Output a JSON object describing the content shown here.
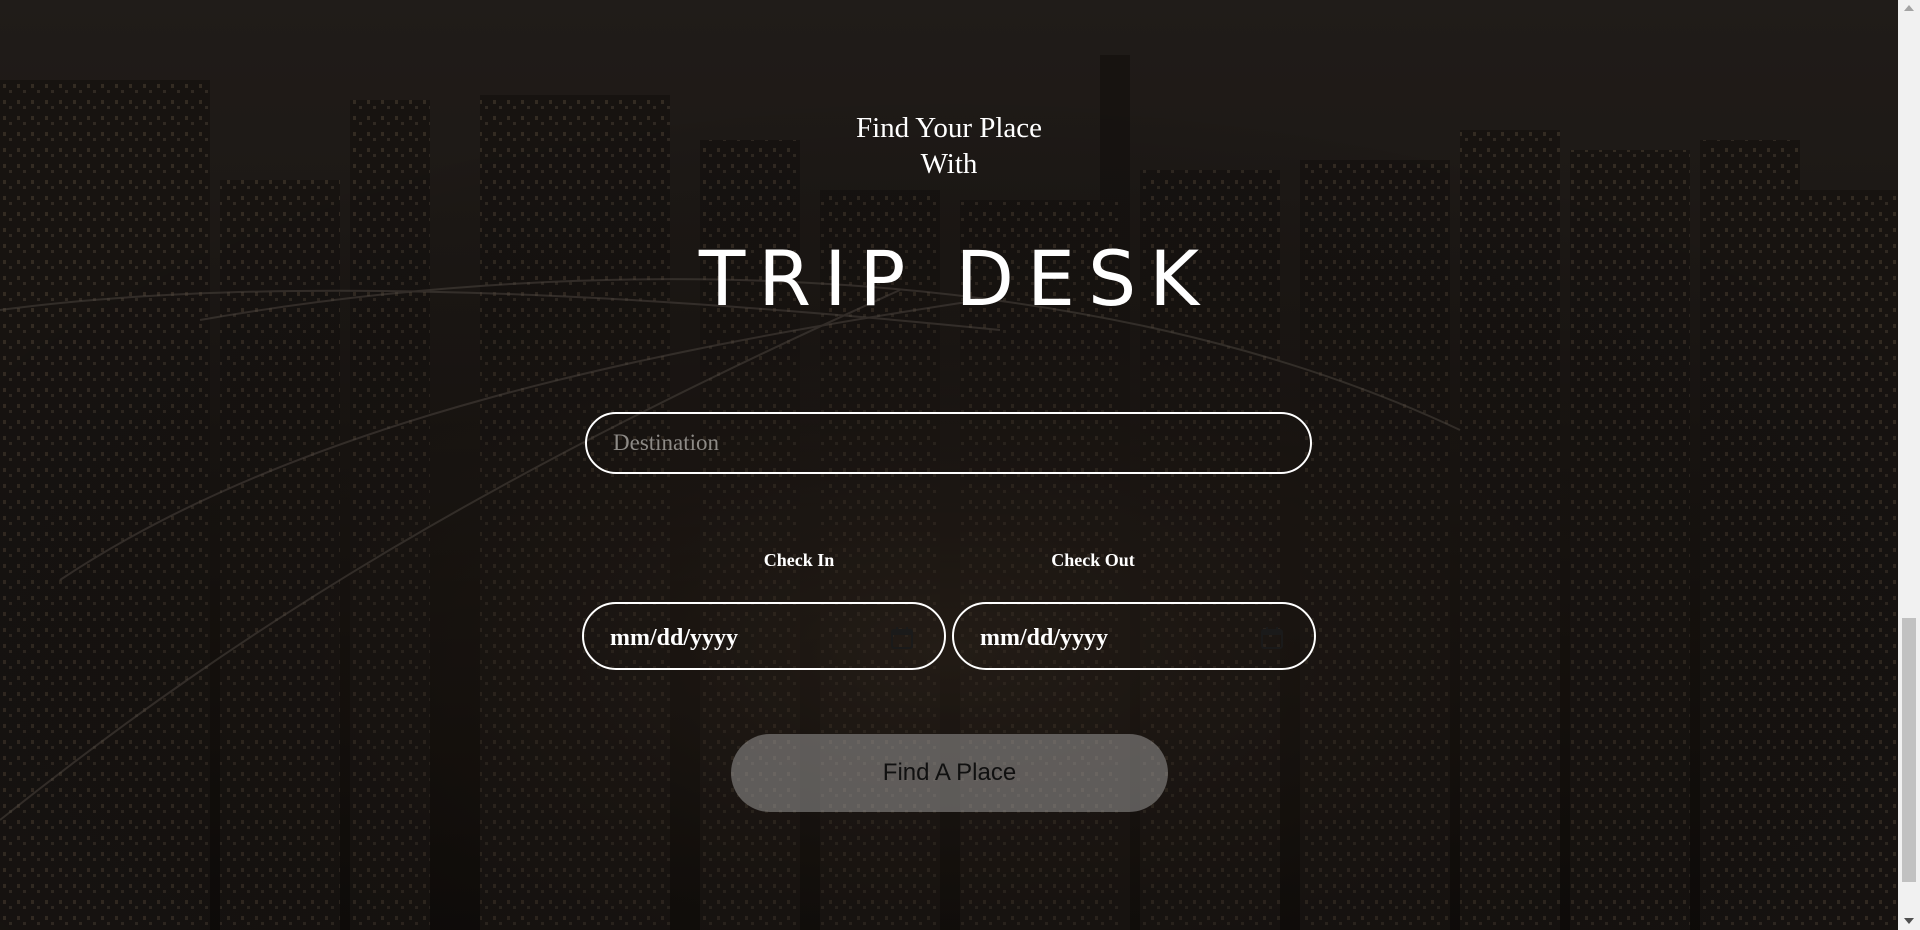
{
  "hero": {
    "tagline_line1": "Find Your Place",
    "tagline_line2": "With",
    "brand": "TRIP DESK"
  },
  "search": {
    "destination_placeholder": "Destination",
    "destination_value": "",
    "check_in_label": "Check In",
    "check_out_label": "Check Out",
    "check_in_value": "mm/dd/yyyy",
    "check_out_value": "mm/dd/yyyy",
    "submit_label": "Find A Place"
  },
  "icons": {
    "calendar": "calendar-icon"
  },
  "colors": {
    "text": "#ffffff",
    "overlay": "#120f0d",
    "button_bg": "rgba(190,190,190,0.42)"
  }
}
